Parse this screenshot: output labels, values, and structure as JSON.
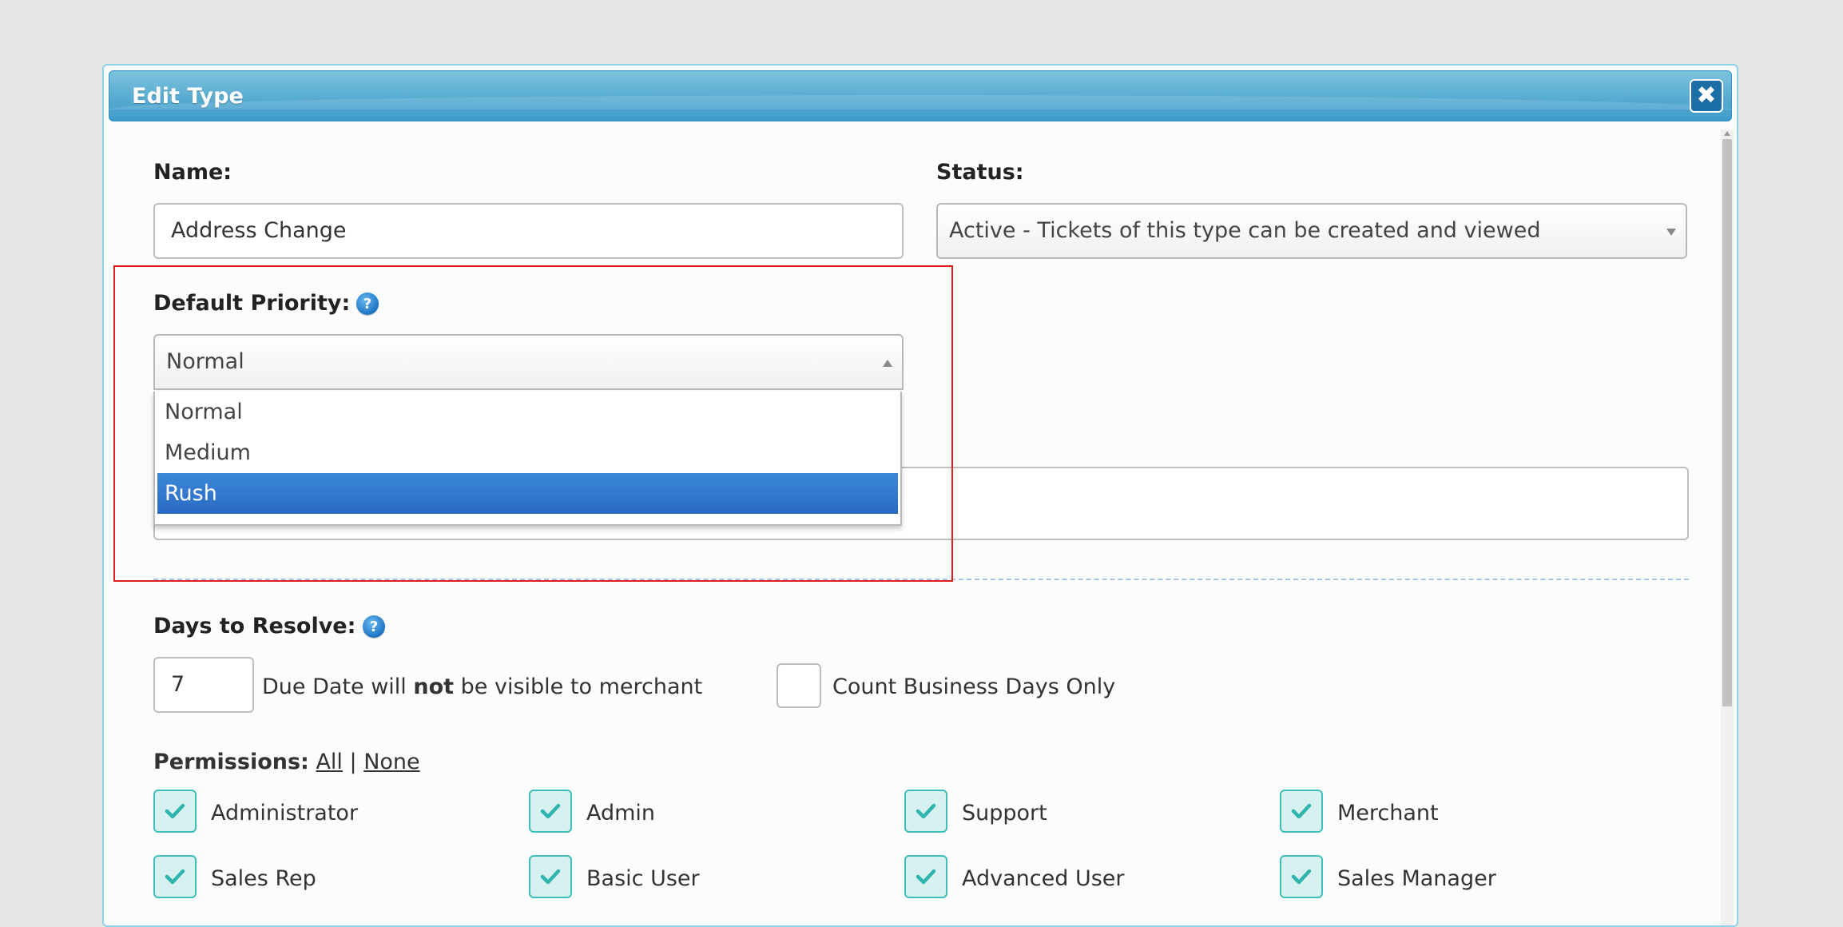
{
  "dialog": {
    "title": "Edit Type",
    "close_icon": "close-icon"
  },
  "form": {
    "name_label": "Name:",
    "name_value": "Address Change",
    "status_label": "Status:",
    "status_value": "Active - Tickets of this type can be created and viewed",
    "priority_label": "Default Priority:",
    "priority_value": "Normal",
    "priority_options": [
      "Normal",
      "Medium",
      "Rush"
    ],
    "priority_highlighted": "Rush",
    "days_label": "Days to Resolve:",
    "days_value": "7",
    "due_date_note_pre": "Due Date will ",
    "due_date_note_bold": "not",
    "due_date_note_post": " be visible to merchant",
    "business_days_label": "Count Business Days Only",
    "permissions_label": "Permissions:",
    "permissions_all": "All",
    "permissions_sep": "|",
    "permissions_none": "None",
    "roles": [
      "Administrator",
      "Admin",
      "Support",
      "Merchant",
      "Sales Rep",
      "Basic User",
      "Advanced User",
      "Sales Manager"
    ]
  },
  "colors": {
    "titlebar": "#5fb0d3",
    "accent_check": "#3dbfb8",
    "highlight_box": "#e01e1e",
    "selected_option": "#2a6ac5"
  }
}
